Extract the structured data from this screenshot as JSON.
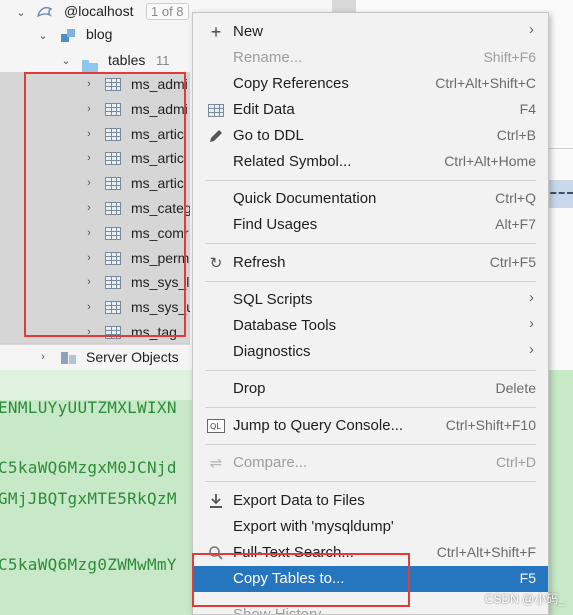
{
  "tree": {
    "connection": {
      "name": "@localhost",
      "page_indicator": "1 of 8"
    },
    "schema": {
      "name": "blog"
    },
    "tables_folder": {
      "name": "tables",
      "count": "11"
    },
    "tables": [
      "ms_admi",
      "ms_admi",
      "ms_artic",
      "ms_artic",
      "ms_artic",
      "ms_categ",
      "ms_comr",
      "ms_perm",
      "ms_sys_lo",
      "ms_sys_u",
      "ms_tag"
    ],
    "server_objects": "Server Objects"
  },
  "results_lines": [
    "ENMLUYyUUTZMXLWIXN",
    "C5kaWQ6MzgxM0JCNjd",
    "GMjJBQTgxMTE5RkQzM",
    "C5kaWQ6Mzg0ZWMwMmY"
  ],
  "menu": {
    "items": [
      {
        "label": "New",
        "shortcut": "",
        "submenu": true,
        "icon": "plus-icon",
        "disabled": false
      },
      {
        "label": "Rename...",
        "shortcut": "Shift+F6",
        "disabled": true
      },
      {
        "label": "Copy References",
        "shortcut": "Ctrl+Alt+Shift+C"
      },
      {
        "label": "Edit Data",
        "shortcut": "F4",
        "icon": "table-icon"
      },
      {
        "label": "Go to DDL",
        "shortcut": "Ctrl+B",
        "icon": "edit-icon"
      },
      {
        "label": "Related Symbol...",
        "shortcut": "Ctrl+Alt+Home"
      },
      {
        "label": "Quick Documentation",
        "shortcut": "Ctrl+Q"
      },
      {
        "label": "Find Usages",
        "shortcut": "Alt+F7"
      },
      {
        "label": "Refresh",
        "shortcut": "Ctrl+F5",
        "icon": "refresh-icon"
      },
      {
        "label": "SQL Scripts",
        "submenu": true
      },
      {
        "label": "Database Tools",
        "submenu": true
      },
      {
        "label": "Diagnostics",
        "submenu": true
      },
      {
        "label": "Drop",
        "shortcut": "Delete"
      },
      {
        "label": "Jump to Query Console...",
        "shortcut": "Ctrl+Shift+F10",
        "icon": "console-icon"
      },
      {
        "label": "Compare...",
        "shortcut": "Ctrl+D",
        "disabled": true,
        "icon": "compare-icon"
      },
      {
        "label": "Export Data to Files",
        "shortcut": "",
        "icon": "download-icon"
      },
      {
        "label": "Export with 'mysqldump'",
        "shortcut": ""
      },
      {
        "label": "Full-Text Search...",
        "shortcut": "Ctrl+Alt+Shift+F",
        "icon": "search-icon"
      },
      {
        "label": "Copy Tables to...",
        "shortcut": "F5",
        "highlighted": true
      },
      {
        "label": "Show History",
        "shortcut": ""
      }
    ]
  },
  "watermark": "CSDN @小码_",
  "colors": {
    "highlight": "#2675bf",
    "annotation_red": "#e23b3b",
    "results_green": "#c7e9c7"
  }
}
